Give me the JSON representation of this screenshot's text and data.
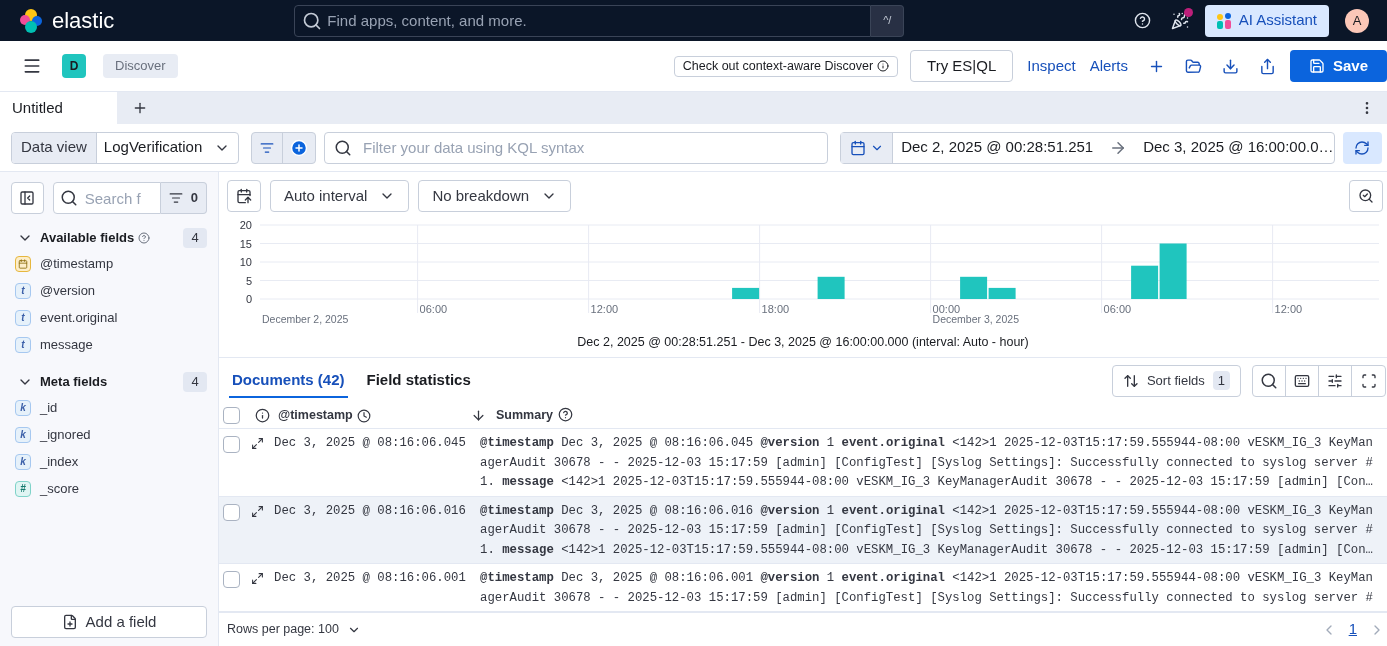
{
  "header": {
    "logo_text": "elastic",
    "search": {
      "placeholder": "Find apps, content, and more.",
      "shortcut": "^/"
    },
    "notification": true,
    "ai_button": "AI Assistant",
    "avatar": "A"
  },
  "app_bar": {
    "space": "D",
    "breadcrumb": "Discover",
    "notice": "Check out context-aware Discover",
    "actions": [
      {
        "kind": "outline",
        "label": "Try ES|QL"
      },
      {
        "kind": "link",
        "label": "Inspect"
      },
      {
        "kind": "link",
        "label": "Alerts"
      }
    ],
    "save": "Save"
  },
  "tabs": [
    {
      "label": "Untitled",
      "selected": true
    }
  ],
  "query_bar": {
    "data_view_label": "Data view",
    "data_view": "LogVerification",
    "placeholder": "Filter your data using KQL syntax",
    "start": "Dec 2, 2025 @ 00:28:51.251",
    "end": "Dec 3, 2025 @ 16:00:00.0…"
  },
  "sidebar": {
    "search_placeholder": "Search f",
    "filter_count": "0",
    "groups": [
      {
        "title": "Available fields",
        "count": "4",
        "expanded": true,
        "help": true,
        "fields": [
          {
            "name": "@timestamp",
            "kind": "date"
          },
          {
            "name": "@version",
            "kind": "text",
            "badge": "t"
          },
          {
            "name": "event.original",
            "kind": "text",
            "badge": "t"
          },
          {
            "name": "message",
            "kind": "text",
            "badge": "t"
          }
        ]
      },
      {
        "title": "Meta fields",
        "count": "4",
        "expanded": true,
        "help": false,
        "fields": [
          {
            "name": "_id",
            "kind": "keyword",
            "badge": "k"
          },
          {
            "name": "_ignored",
            "kind": "keyword",
            "badge": "k"
          },
          {
            "name": "_index",
            "kind": "keyword",
            "badge": "k"
          },
          {
            "name": "_score",
            "kind": "number",
            "badge": "#"
          }
        ]
      }
    ],
    "add_field": "Add a field"
  },
  "histogram": {
    "interval": "Auto interval",
    "breakdown": "No breakdown",
    "date_labels": [
      "December 2, 2025",
      "December 3, 2025"
    ],
    "caption": "Dec 2, 2025 @ 00:28:51.251 - Dec 3, 2025 @ 16:00:00.000 (interval: Auto - hour)",
    "time_labels": [
      "06:00",
      "12:00",
      "18:00",
      "00:00",
      "06:00",
      "12:00"
    ],
    "chart_data": {
      "type": "bar",
      "grid": true,
      "series": [
        {
          "color": "#20c5be",
          "values": [
            0,
            0,
            0,
            0,
            0,
            0,
            0,
            0,
            0,
            0,
            0,
            0,
            0,
            0,
            0,
            0,
            0,
            3,
            0,
            0,
            6,
            0,
            0,
            0,
            0,
            6,
            3,
            0,
            0,
            0,
            0,
            9,
            15,
            0,
            0,
            0,
            0,
            0,
            0,
            0
          ]
        }
      ],
      "ylim": [
        0,
        20
      ],
      "yticks": [
        0,
        5,
        10,
        15,
        20
      ]
    }
  },
  "documents": {
    "tabs": [
      {
        "label": "Documents (42)",
        "selected": true
      },
      {
        "label": "Field statistics",
        "selected": false
      }
    ],
    "sort_label": "Sort fields",
    "sort_count": "1",
    "all_selected": false,
    "columns": [
      "@timestamp",
      "Summary"
    ],
    "rows": [
      {
        "selected": false,
        "highlighted": false,
        "timestamp": "Dec 3, 2025 @ 08:16:06.045",
        "summary": "**@timestamp** Dec 3, 2025 @ 08:16:06.045 **@version** 1 **event.original** <142>1 2025-12-03T15:17:59.555944-08:00 vESKM_IG_3 KeyManagerAudit 30678 - - 2025-12-03 15:17:59 [admin] [ConfigTest] [Syslog Settings]: Successfully connected to syslog server #1. **message** <142>1 2025-12-03T15:17:59.555944-08:00 vESKM_IG_3 KeyManagerAudit 30678 - - 2025-12-03 15:17:59 [admin] [Con…"
      },
      {
        "selected": false,
        "highlighted": true,
        "timestamp": "Dec 3, 2025 @ 08:16:06.016",
        "summary": "**@timestamp** Dec 3, 2025 @ 08:16:06.016 **@version** 1 **event.original** <142>1 2025-12-03T15:17:59.555944-08:00 vESKM_IG_3 KeyManagerAudit 30678 - - 2025-12-03 15:17:59 [admin] [ConfigTest] [Syslog Settings]: Successfully connected to syslog server #1. **message** <142>1 2025-12-03T15:17:59.555944-08:00 vESKM_IG_3 KeyManagerAudit 30678 - - 2025-12-03 15:17:59 [admin] [Con…"
      },
      {
        "selected": false,
        "highlighted": false,
        "timestamp": "Dec 3, 2025 @ 08:16:06.001",
        "summary": "**@timestamp** Dec 3, 2025 @ 08:16:06.001 **@version** 1 **event.original** <142>1 2025-12-03T15:17:59.555944-08:00 vESKM_IG_3 KeyManagerAudit 30678 - - 2025-12-03 15:17:59 [admin] [ConfigTest] [Syslog Settings]: Successfully connected to syslog server #"
      }
    ],
    "rows_per_page": "Rows per page: 100",
    "page": "1"
  }
}
